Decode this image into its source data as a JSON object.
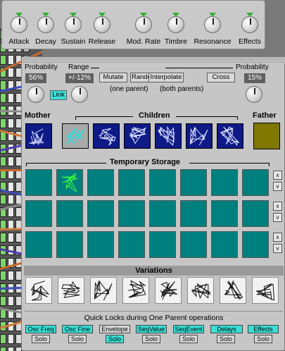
{
  "knob_panel": {
    "knobs": [
      {
        "label": "Attack"
      },
      {
        "label": "Decay"
      },
      {
        "label": "Sustain"
      },
      {
        "label": "Release"
      },
      {
        "label": "Mod. Rate"
      },
      {
        "label": "Timbre"
      },
      {
        "label": "Resonance"
      },
      {
        "label": "Effects"
      }
    ]
  },
  "mutation": {
    "probability_label": "Probability",
    "range_label": "Range",
    "probability_value": "56%",
    "range_value": "+/-12%",
    "link_label": "Link",
    "mutate_label": "Mutate",
    "randomize_label": "Randomize",
    "one_parent_caption": "(one parent)",
    "interpolate_label": "Interpolate",
    "cross_label": "Cross",
    "both_parents_caption": "(both parents)",
    "cross_probability_label": "Probability",
    "cross_probability_value": "15%"
  },
  "family": {
    "mother_label": "Mother",
    "children_label": "Children",
    "father_label": "Father",
    "father_color": "#807800",
    "selected_child_index": 0
  },
  "storage": {
    "title": "Temporary Storage",
    "clear_label": "x",
    "view_label": "v",
    "cell_color": "#007f7f"
  },
  "variations": {
    "title": "Variations"
  },
  "quick_locks": {
    "title": "Quick Locks during One Parent operations",
    "locks": [
      {
        "label": "Osc Freq",
        "active": true
      },
      {
        "label": "Osc Fine",
        "active": true
      },
      {
        "label": "Envelope",
        "active": false
      },
      {
        "label": "SeqValue",
        "active": true
      },
      {
        "label": "SeqEvent",
        "active": true
      },
      {
        "label": "Delays",
        "active": true
      },
      {
        "label": "Effects",
        "active": true
      }
    ],
    "solo_label": "Solo",
    "active_color": "#38e0d7"
  }
}
